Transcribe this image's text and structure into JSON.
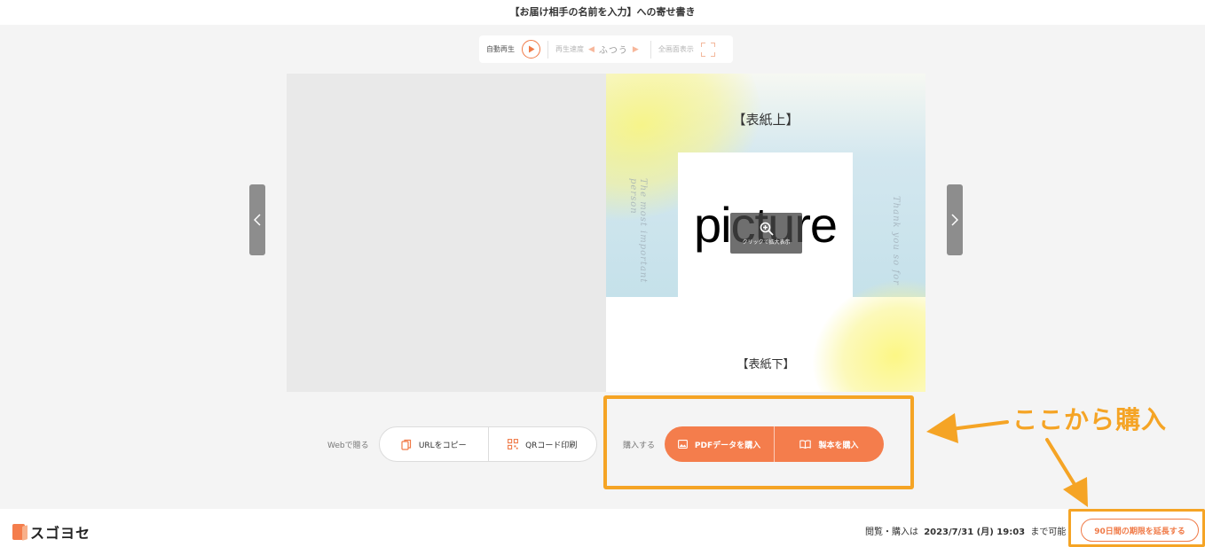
{
  "header": {
    "title": "【お届け相手の名前を入力】への寄せ書き"
  },
  "player": {
    "autoplay_label": "自動再生",
    "speed_label": "再生速度",
    "speed_value": "ふつう",
    "speed_prev": "◀",
    "speed_next": "▶",
    "fullscreen_label": "全画面表示"
  },
  "card": {
    "cover_top": "【表紙上】",
    "cover_bottom": "【表紙下】",
    "photo_text": "picture",
    "zoom_hint": "クリックで拡大表示",
    "script_left": "The most important person",
    "script_right": "Thank you so for"
  },
  "share": {
    "label": "Webで贈る",
    "copy_url": "URLをコピー",
    "qr_print": "QRコード印刷"
  },
  "purchase": {
    "label": "購入する",
    "pdf": "PDFデータを購入",
    "book": "製本を購入"
  },
  "annotation": {
    "text": "ここから購入"
  },
  "footer": {
    "logo": "スゴヨセ",
    "deadline_prefix": "閲覧・購入は",
    "deadline_date": "2023/7/31 (月) 19:03",
    "deadline_suffix": "まで可能",
    "extend_button": "90日間の期限を延長する"
  },
  "colors": {
    "accent": "#f47d4c",
    "annotation": "#f5a425"
  }
}
